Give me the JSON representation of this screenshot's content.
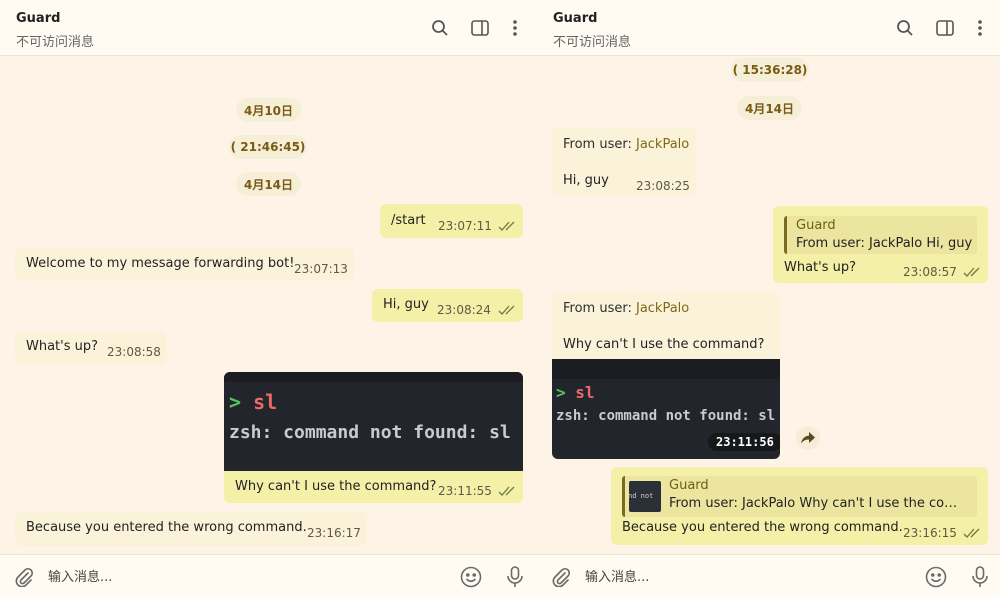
{
  "left": {
    "header": {
      "title": "Guard",
      "subtitle": "不可访问消息"
    },
    "pills": [
      "4月10日",
      "( 21:46:45)",
      "4月14日"
    ],
    "messages": {
      "m1": {
        "text": "/start",
        "time": "23:07:11"
      },
      "m2": {
        "text": "Welcome to my message forwarding bot!",
        "time": "23:07:13"
      },
      "m3": {
        "text": "Hi, guy",
        "time": "23:08:24"
      },
      "m4": {
        "text": "What's up?",
        "time": "23:08:58"
      },
      "m5": {
        "terminal": {
          "prompt": ">",
          "command": "sl",
          "error": "zsh: command not found: sl"
        },
        "text": "Why can't I use the command?",
        "time": "23:11:55"
      },
      "m6": {
        "text": "Because you entered the wrong command.",
        "time": "23:16:17"
      }
    },
    "footer": {
      "placeholder": "输入消息..."
    }
  },
  "right": {
    "header": {
      "title": "Guard",
      "subtitle": "不可访问消息"
    },
    "pills": [
      "( 15:36:28)",
      "4月14日"
    ],
    "messages": {
      "r1": {
        "from_label": "From user: ",
        "from_name": "JackPalo",
        "text": "Hi, guy",
        "time": "23:08:25"
      },
      "r2": {
        "quote_title": "Guard",
        "quote_text": "From user: JackPalo   Hi, guy",
        "text": "What's up?",
        "time": "23:08:57"
      },
      "r3": {
        "from_label": "From user: ",
        "from_name": "JackPalo",
        "text": "Why can't I use the command?",
        "terminal": {
          "prompt": ">",
          "command": "sl",
          "error": "zsh: command not found: sl"
        },
        "time": "23:11:56"
      },
      "r4": {
        "quote_title": "Guard",
        "quote_thumb": "nd not",
        "quote_text": "From user: JackPalo   Why can't I use the com...",
        "text": "Because you entered the wrong command.",
        "time": "23:16:15"
      }
    },
    "footer": {
      "placeholder": "输入消息..."
    }
  }
}
